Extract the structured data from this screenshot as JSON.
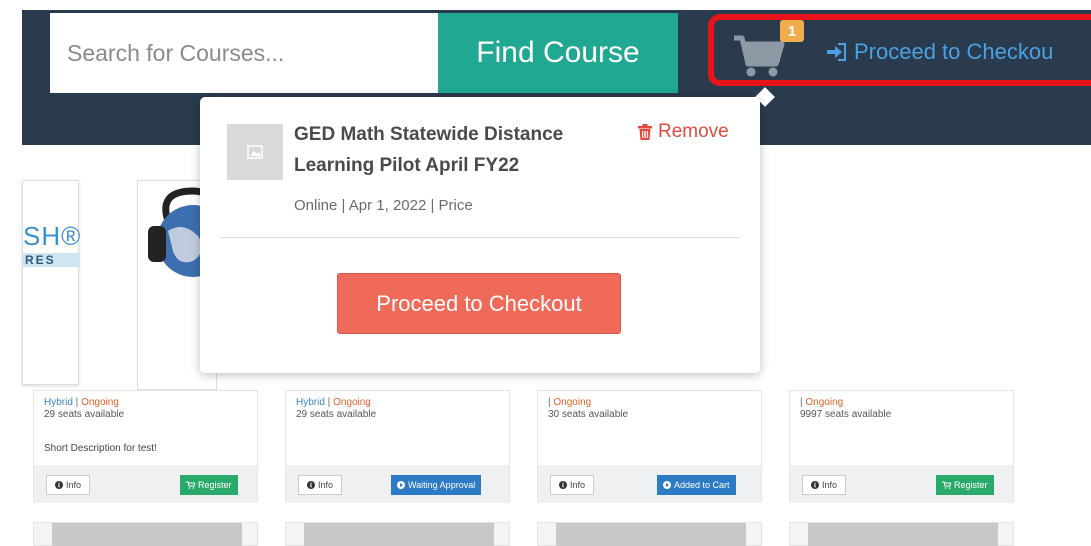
{
  "search": {
    "placeholder": "Search for Courses...",
    "button_label": "Find Course"
  },
  "cart": {
    "badge_count": "1",
    "checkout_link": "Proceed to Checkou",
    "icon": "cart-icon"
  },
  "popover": {
    "item_title": "GED Math Statewide Distance Learning Pilot April FY22",
    "item_meta": "Online | Apr 1, 2022 | Price",
    "remove_label": "Remove",
    "checkout_button": "Proceed to Checkout"
  },
  "background_cards": {
    "left_brand_line1": "SH®",
    "left_brand_line2": "RES"
  },
  "courses": [
    {
      "mode": "Hybrid",
      "sep": " | ",
      "status": "Ongoing",
      "seats": "29 seats available",
      "description": "Short Description for test!",
      "info_label": "Info",
      "action_label": "Register",
      "action_style": "green"
    },
    {
      "mode": "Hybrid",
      "sep": " | ",
      "status": "Ongoing",
      "seats": "29 seats available",
      "description": "",
      "info_label": "Info",
      "action_label": "Waiting Approval",
      "action_style": "blue"
    },
    {
      "mode": "",
      "sep": "| ",
      "status": "Ongoing",
      "seats": "30 seats available",
      "description": "",
      "info_label": "Info",
      "action_label": "Added to Cart",
      "action_style": "blue"
    },
    {
      "mode": "",
      "sep": "| ",
      "status": "Ongoing",
      "seats": "9997 seats available",
      "description": "",
      "info_label": "Info",
      "action_label": "Register",
      "action_style": "green"
    }
  ],
  "colors": {
    "header_bg": "#2b3b4e",
    "find_button": "#21a892",
    "highlight": "#e8141c",
    "link_blue": "#4aa0e0",
    "checkout_button": "#f06a5a",
    "status_orange": "#e0622a"
  }
}
